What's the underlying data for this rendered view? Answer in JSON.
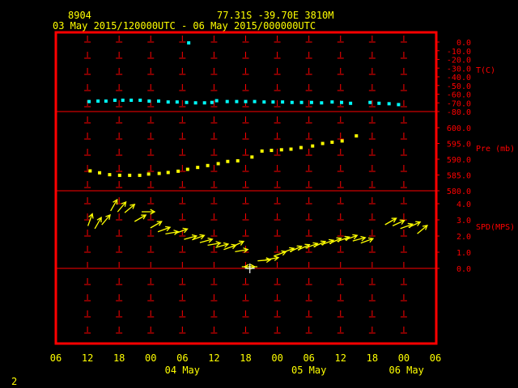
{
  "header": {
    "station": "8904",
    "location": "77.31S   -39.70E   3810M",
    "period": "03 May 2015/120000UTC - 06 May 2015/000000UTC",
    "page_number": "2"
  },
  "colors": {
    "frame": "#ff0000",
    "grid": "#ff0000",
    "text": "#ffff00",
    "temperature": "#00ffff",
    "pressure": "#ffff00",
    "wind": "#ffff00",
    "axis_text": "#ff0000"
  },
  "chart_data": {
    "type": "scatter",
    "x_axis": {
      "unit": "hours since 03 May 2015 06 UTC",
      "range": [
        0,
        72
      ],
      "tick_values": [
        0,
        6,
        12,
        18,
        24,
        30,
        36,
        42,
        48,
        54,
        60,
        66,
        72
      ],
      "tick_labels": [
        "06",
        "12",
        "18",
        "00",
        "06",
        "12",
        "18",
        "00",
        "06",
        "12",
        "18",
        "00",
        "06"
      ],
      "date_labels": [
        {
          "x": 24,
          "label": "04 May"
        },
        {
          "x": 48,
          "label": "05 May"
        },
        {
          "x": 66.5,
          "label": "06 May"
        }
      ]
    },
    "panels": [
      {
        "name": "temperature",
        "label": "T(C)",
        "ylim": [
          -80,
          0
        ],
        "ticks": [
          "0.0",
          "-10.0",
          "-20.0",
          "-30.0",
          "-40.0",
          "-50.0",
          "-60.0",
          "-70.0",
          "-80.0"
        ],
        "tick_values": [
          0,
          -10,
          -20,
          -30,
          -40,
          -50,
          -60,
          -70,
          -80
        ],
        "points": [
          [
            25.2,
            -1
          ],
          [
            6.3,
            -68.5
          ],
          [
            8,
            -68
          ],
          [
            9.5,
            -68
          ],
          [
            11.2,
            -67
          ],
          [
            12.7,
            -67
          ],
          [
            14.3,
            -67
          ],
          [
            16,
            -67
          ],
          [
            17.7,
            -68
          ],
          [
            19.5,
            -68
          ],
          [
            21.3,
            -69
          ],
          [
            23,
            -69
          ],
          [
            24.8,
            -69.5
          ],
          [
            26.5,
            -70
          ],
          [
            28.2,
            -70
          ],
          [
            29.6,
            -69.5
          ],
          [
            30.5,
            -67.5
          ],
          [
            32.5,
            -68.5
          ],
          [
            34.3,
            -68.5
          ],
          [
            36,
            -68.5
          ],
          [
            37.7,
            -68.5
          ],
          [
            39.5,
            -69
          ],
          [
            41.2,
            -69
          ],
          [
            43,
            -69
          ],
          [
            44.8,
            -69.5
          ],
          [
            46.6,
            -69.5
          ],
          [
            48.5,
            -69.5
          ],
          [
            50.4,
            -70
          ],
          [
            52.4,
            -69
          ],
          [
            54.2,
            -69.5
          ],
          [
            55.9,
            -70.5
          ],
          [
            59.6,
            -69.5
          ],
          [
            61.3,
            -70.5
          ],
          [
            63.2,
            -71
          ],
          [
            65,
            -72
          ]
        ]
      },
      {
        "name": "pressure",
        "label": "Pre (mb)",
        "ylim": [
          580,
          600
        ],
        "ticks": [
          "600.0",
          "595.0",
          "590.0",
          "585.0",
          "580.0"
        ],
        "tick_values": [
          600,
          595,
          590,
          585,
          580
        ],
        "points": [
          [
            6.5,
            586.3
          ],
          [
            8.3,
            585.7
          ],
          [
            10.2,
            585.1
          ],
          [
            12.1,
            584.9
          ],
          [
            14,
            584.9
          ],
          [
            15.9,
            584.9
          ],
          [
            17.6,
            585.3
          ],
          [
            19.6,
            585.5
          ],
          [
            21.3,
            585.8
          ],
          [
            23.2,
            586.2
          ],
          [
            25,
            586.8
          ],
          [
            26.9,
            587.4
          ],
          [
            28.8,
            588
          ],
          [
            30.8,
            588.6
          ],
          [
            32.6,
            589.3
          ],
          [
            34.5,
            589.5
          ],
          [
            37.2,
            590.7
          ],
          [
            39.1,
            592.6
          ],
          [
            40.9,
            592.8
          ],
          [
            42.8,
            593
          ],
          [
            44.6,
            593.2
          ],
          [
            46.5,
            593.7
          ],
          [
            48.7,
            594.2
          ],
          [
            50.6,
            595
          ],
          [
            52.4,
            595.4
          ],
          [
            54.3,
            595.8
          ],
          [
            57,
            597.4
          ]
        ]
      },
      {
        "name": "wind",
        "label": "SPD(MPS)",
        "ylim": [
          0,
          4
        ],
        "ticks": [
          "4.0",
          "3.0",
          "2.0",
          "1.0",
          "0.0"
        ],
        "tick_values": [
          4,
          3,
          2,
          1,
          0
        ],
        "vectors": [
          {
            "t": 6.5,
            "spd": 3.0,
            "dir": 200
          },
          {
            "t": 8.0,
            "spd": 2.8,
            "dir": 210
          },
          {
            "t": 9.5,
            "spd": 3.0,
            "dir": 220
          },
          {
            "t": 11.0,
            "spd": 3.9,
            "dir": 210
          },
          {
            "t": 12.5,
            "spd": 3.8,
            "dir": 220
          },
          {
            "t": 14.0,
            "spd": 3.7,
            "dir": 230
          },
          {
            "t": 16.0,
            "spd": 3.1,
            "dir": 240
          },
          {
            "t": 17.5,
            "spd": 3.5,
            "dir": 270
          },
          {
            "t": 19.0,
            "spd": 2.7,
            "dir": 240
          },
          {
            "t": 20.5,
            "spd": 2.4,
            "dir": 250
          },
          {
            "t": 22.0,
            "spd": 2.2,
            "dir": 260
          },
          {
            "t": 23.8,
            "spd": 2.3,
            "dir": 250
          },
          {
            "t": 25.5,
            "spd": 1.9,
            "dir": 255
          },
          {
            "t": 27.0,
            "spd": 1.9,
            "dir": 250
          },
          {
            "t": 28.5,
            "spd": 1.7,
            "dir": 255
          },
          {
            "t": 30.0,
            "spd": 1.5,
            "dir": 260
          },
          {
            "t": 31.5,
            "spd": 1.4,
            "dir": 255
          },
          {
            "t": 33.0,
            "spd": 1.3,
            "dir": 250
          },
          {
            "t": 34.5,
            "spd": 1.5,
            "dir": 245
          },
          {
            "t": 35.2,
            "spd": 1.1,
            "dir": 260
          },
          {
            "t": 36.5,
            "spd": 0.1,
            "dir": 270
          },
          {
            "t": 37.0,
            "spd": 0.1,
            "dir": 90
          },
          {
            "t": 39.5,
            "spd": 0.5,
            "dir": 265
          },
          {
            "t": 41.0,
            "spd": 0.6,
            "dir": 260
          },
          {
            "t": 42.5,
            "spd": 0.9,
            "dir": 250
          },
          {
            "t": 44.0,
            "spd": 1.1,
            "dir": 250
          },
          {
            "t": 45.5,
            "spd": 1.2,
            "dir": 245
          },
          {
            "t": 47.0,
            "spd": 1.3,
            "dir": 245
          },
          {
            "t": 48.5,
            "spd": 1.4,
            "dir": 250
          },
          {
            "t": 50.0,
            "spd": 1.5,
            "dir": 245
          },
          {
            "t": 51.5,
            "spd": 1.6,
            "dir": 250
          },
          {
            "t": 53.0,
            "spd": 1.7,
            "dir": 245
          },
          {
            "t": 54.5,
            "spd": 1.8,
            "dir": 250
          },
          {
            "t": 56.0,
            "spd": 1.9,
            "dir": 250
          },
          {
            "t": 57.5,
            "spd": 1.8,
            "dir": 255
          },
          {
            "t": 59.0,
            "spd": 1.7,
            "dir": 250
          },
          {
            "t": 63.5,
            "spd": 2.9,
            "dir": 240
          },
          {
            "t": 65.0,
            "spd": 2.8,
            "dir": 245
          },
          {
            "t": 66.5,
            "spd": 2.6,
            "dir": 250
          },
          {
            "t": 68.0,
            "spd": 2.7,
            "dir": 245
          },
          {
            "t": 69.5,
            "spd": 2.4,
            "dir": 230
          }
        ]
      }
    ]
  }
}
